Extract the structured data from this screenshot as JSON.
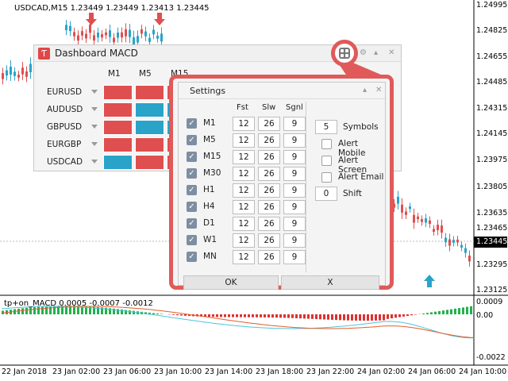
{
  "chart": {
    "title": "USDCAD,M15  1.23449 1.23449 1.23413 1.23445",
    "current_price": "1.23445",
    "price_labels": [
      "1.24995",
      "1.24825",
      "1.24655",
      "1.24485",
      "1.24315",
      "1.24145",
      "1.23975",
      "1.23805",
      "1.23635",
      "1.23465",
      "1.23295",
      "1.23125"
    ],
    "time_labels": [
      "22 Jan 2018",
      "23 Jan 02:00",
      "23 Jan 06:00",
      "23 Jan 10:00",
      "23 Jan 14:00",
      "23 Jan 18:00",
      "23 Jan 22:00",
      "24 Jan 02:00",
      "24 Jan 06:00",
      "24 Jan 10:00"
    ],
    "indicator_title": "tp+on_MACD 0.0005 -0.0007 -0.0012",
    "indicator_labels": [
      "0.0009",
      "0.00",
      "-0.0022"
    ],
    "colors": {
      "bull": "#2aa3c8",
      "bear": "#e04f4f",
      "macd_up": "#22b14c",
      "macd_down": "#e03030"
    }
  },
  "dashboard": {
    "title": "Dashboard MACD",
    "timeframes": [
      "M1",
      "M5",
      "M15",
      "M30",
      "H1",
      "H4",
      "D1",
      "W1",
      "MN"
    ],
    "symbols": [
      {
        "name": "EURUSD",
        "cells": [
          "red",
          "red",
          "red"
        ]
      },
      {
        "name": "AUDUSD",
        "cells": [
          "red",
          "blue",
          "blue"
        ]
      },
      {
        "name": "GBPUSD",
        "cells": [
          "red",
          "blue",
          "blue"
        ]
      },
      {
        "name": "EURGBP",
        "cells": [
          "red",
          "red",
          "red"
        ]
      },
      {
        "name": "USDCAD",
        "cells": [
          "blue",
          "red",
          "red"
        ]
      }
    ]
  },
  "settings": {
    "title": "Settings",
    "col_fast": "Fst",
    "col_slow": "Slw",
    "col_signal": "Sgnl",
    "rows": [
      {
        "tf": "M1",
        "fast": "12",
        "slow": "26",
        "signal": "9"
      },
      {
        "tf": "M5",
        "fast": "12",
        "slow": "26",
        "signal": "9"
      },
      {
        "tf": "M15",
        "fast": "12",
        "slow": "26",
        "signal": "9"
      },
      {
        "tf": "M30",
        "fast": "12",
        "slow": "26",
        "signal": "9"
      },
      {
        "tf": "H1",
        "fast": "12",
        "slow": "26",
        "signal": "9"
      },
      {
        "tf": "H4",
        "fast": "12",
        "slow": "26",
        "signal": "9"
      },
      {
        "tf": "D1",
        "fast": "12",
        "slow": "26",
        "signal": "9"
      },
      {
        "tf": "W1",
        "fast": "12",
        "slow": "26",
        "signal": "9"
      },
      {
        "tf": "MN",
        "fast": "12",
        "slow": "26",
        "signal": "9"
      }
    ],
    "symbols_value": "5",
    "symbols_label": "Symbols",
    "alert_mobile": "Alert Mobile",
    "alert_screen": "Alert Screen",
    "alert_email": "Alert Email",
    "shift_value": "0",
    "shift_label": "Shift",
    "ok_label": "OK",
    "cancel_label": "X"
  }
}
